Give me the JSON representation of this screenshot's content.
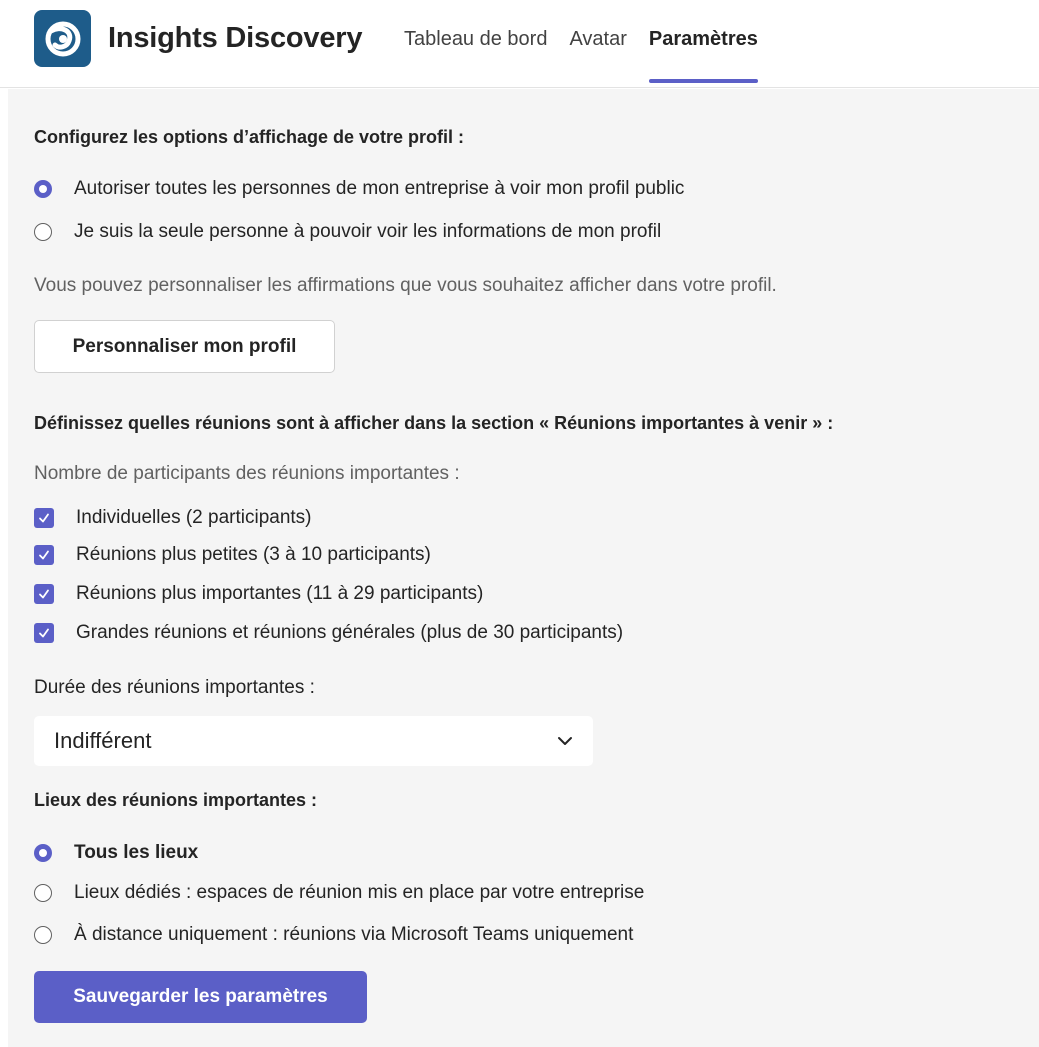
{
  "app": {
    "title": "Insights Discovery",
    "accent_color": "#5b5fc7",
    "logo_color": "#1e5c8a"
  },
  "tabs": [
    {
      "label": "Tableau de bord",
      "active": false
    },
    {
      "label": "Avatar",
      "active": false
    },
    {
      "label": "Paramètres",
      "active": true
    }
  ],
  "profile_section": {
    "heading": "Configurez les options d’affichage de votre profil :",
    "options": [
      {
        "label": "Autoriser toutes les personnes de mon entreprise à voir mon profil public",
        "selected": true
      },
      {
        "label": "Je suis la seule personne à pouvoir voir les informations de mon profil",
        "selected": false
      }
    ],
    "description": "Vous pouvez personnaliser les affirmations que vous souhaitez afficher dans votre profil.",
    "customize_button": "Personnaliser mon profil"
  },
  "meetings_section": {
    "heading": "Définissez quelles réunions sont à afficher dans la section « Réunions importantes à venir » :",
    "participants_label": "Nombre de participants des réunions importantes :",
    "participant_options": [
      {
        "label": "Individuelles (2 participants)",
        "checked": true
      },
      {
        "label": "Réunions plus petites (3 à 10 participants)",
        "checked": true
      },
      {
        "label": "Réunions plus importantes (11 à 29 participants)",
        "checked": true
      },
      {
        "label": "Grandes réunions et réunions générales (plus de 30 participants)",
        "checked": true
      }
    ],
    "duration_label": "Durée des réunions importantes :",
    "duration_value": "Indifférent",
    "locations_heading": "Lieux des réunions importantes :",
    "location_options": [
      {
        "label": "Tous les lieux",
        "selected": true
      },
      {
        "label": "Lieux dédiés : espaces de réunion mis en place par votre entreprise",
        "selected": false
      },
      {
        "label": "À distance uniquement : réunions via Microsoft Teams uniquement",
        "selected": false
      }
    ]
  },
  "save_button": "Sauvegarder les paramètres",
  "icons": {
    "logo": "insights-logo-icon",
    "dropdown": "chevron-down-icon",
    "checkbox": "checkmark-icon"
  }
}
